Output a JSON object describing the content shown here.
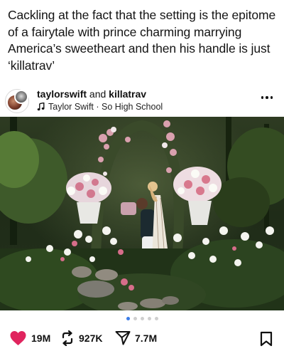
{
  "caption": "Cackling at the fact that the setting is the epitome of a fairytale with prince charming marrying America’s sweetheart and then his handle is just ‘killatrav’",
  "post": {
    "user1": "taylorswift",
    "connector": "and",
    "user2": "killatrav",
    "music": "Taylor Swift · So High School",
    "more_icon": "more-horizontal-icon"
  },
  "carousel": {
    "count": 5,
    "active": 0
  },
  "actions": {
    "likes": "19M",
    "reposts": "927K",
    "shares": "7.7M"
  },
  "colors": {
    "like": "#e0245e",
    "active_dot": "#3b7de9",
    "inactive_dot": "#cfcfcf"
  }
}
